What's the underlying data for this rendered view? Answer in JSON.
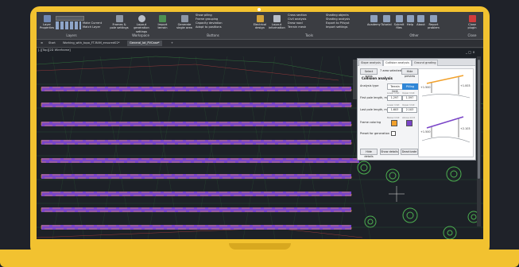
{
  "ribbon": {
    "layer_properties": "Layer\nProperties",
    "make_current": "Make Current",
    "match_layer": "Match Layer",
    "layers_label": "Layers",
    "frames_pile": "Frames & pole\nsettings",
    "layout_gen": "Layout generation\nsettings",
    "import_terrain": "Import terrain",
    "workspace_label": "Workspace",
    "generate_single": "Generate single\narea",
    "show_piling": "Show piling",
    "frame_grouping": "Frame grouping",
    "capacity_deviation": "Capacity deviation",
    "adapt_positions": "Adapt to positions",
    "buttons_label": "Buttons",
    "electrical_design": "Electrical\ndesign",
    "layout_info": "Layout\ninformation",
    "cross_section": "Cross section",
    "civil_analysis": "Civil analysis",
    "draw_road": "Draw road",
    "terrain_mesh": "Terrain mesh",
    "shading_objects": "Shading objects",
    "shading_analysis": "Shading analysis",
    "export_pvsyst": "Export to PVsyst",
    "import_settings": "Import settings",
    "tools_label": "Tools",
    "academy": "Academy",
    "tutorial": "Tutorial",
    "submit_files": "Submit\nfiles",
    "help": "Help",
    "about": "About",
    "report_problem": "Report\nproblem",
    "other_label": "Other",
    "close_plugin": "Close\nplugin",
    "close_label": "Close"
  },
  "tabs": {
    "start": "Start",
    "file1": "Working_with_topo_FT-RAM_ensured02*",
    "file2": "General_lot_PVCase*"
  },
  "viewport": {
    "view_label": "[-][Top][2D Wireframe]",
    "win_controls": "_ □ ×",
    "side_label": "PVCASE"
  },
  "panel": {
    "tabs": [
      "Slope analysis",
      "Collision analysis",
      "Ground grading"
    ],
    "select_areas": "Select areas",
    "frames_selected": "7 area selected",
    "hide_preview": "Hide preview",
    "section_title": "Collision analysis",
    "analysis_type": "Analysis type",
    "mode_a": "Terrain limit",
    "mode_b": "Pilling range",
    "first_pole_length": "First pole length, m",
    "last_pole_length": "Last pole length, m",
    "lower_limit": "Lower limit",
    "upper_limit": "Upper limit",
    "first_lower": "1.297",
    "first_upper": "1.597",
    "last_lower": "1.603",
    "last_upper": "2.103",
    "frame_coloring": "Frame coloring",
    "below_limit": "Below limit",
    "above_limit": "Above limit",
    "preset_generation": "Preset for generation",
    "hide_details": "Hide details",
    "show_details": "Show details",
    "deactivate": "Deactivate",
    "dim_top_left": "+1.500",
    "dim_top_right": "+1.003",
    "dim_bottom_left": "+1.500",
    "dim_bottom_right": "+2.103"
  },
  "colors": {
    "frame_orange": "#f2a12b",
    "frame_purple": "#7a45c8",
    "mesh_green": "#3fa74a",
    "mesh_red": "#c94444",
    "laptop_yellow": "#f2c230"
  }
}
